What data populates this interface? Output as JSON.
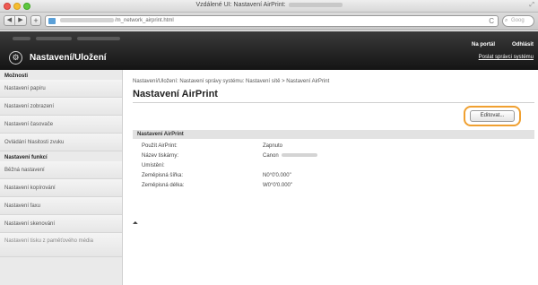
{
  "window": {
    "title": "Vzdálené UI: Nastavení AirPrint:"
  },
  "toolbar": {
    "back_icon": "chevron-left-icon",
    "forward_icon": "chevron-right-icon",
    "add_label": "+",
    "url": "/m_network_airprint.html",
    "reload_label": "C",
    "search_placeholder": "Goog"
  },
  "header": {
    "app_title": "Nastavení/Uložení",
    "portal_label": "Na portál",
    "logout_label": "Odhlásit",
    "system_mgmt_label": "Poslat správci systému"
  },
  "sidebar": {
    "section_prefs": "Možnosti",
    "pref_items": [
      {
        "label": "Nastavení papíru"
      },
      {
        "label": "Nastavení zobrazení"
      },
      {
        "label": "Nastavení časovače"
      },
      {
        "label": "Ovládání hlasitosti zvuku"
      }
    ],
    "section_functions": "Nastavení funkcí",
    "function_items": [
      {
        "label": "Běžná nastavení"
      },
      {
        "label": "Nastavení kopírování"
      },
      {
        "label": "Nastavení faxu"
      },
      {
        "label": "Nastavení skenování"
      },
      {
        "label": "Nastavení tisku z paměťového média"
      }
    ]
  },
  "main": {
    "breadcrumb": "Nastavení/Uložení: Nastavení správy systému: Nastavení sítě > Nastavení AirPrint",
    "page_title": "Nastavení AirPrint",
    "edit_label": "Editovat...",
    "section_title": "Nastavení AirPrint",
    "rows": [
      {
        "label": "Použít AirPrint:",
        "value": "Zapnuto"
      },
      {
        "label": "Název tiskárny:",
        "value": "Canon"
      },
      {
        "label": "Umístění:",
        "value": ""
      },
      {
        "label": "Zeměpisná šířka:",
        "value": "N0°0'0.000\""
      },
      {
        "label": "Zeměpisná délka:",
        "value": "W0°0'0.000\""
      }
    ],
    "to_top_label": "⏶"
  },
  "colors": {
    "header_bg": "#1c1c1c",
    "sidebar_bg": "#eaeaea",
    "highlight": "#f0a030"
  }
}
